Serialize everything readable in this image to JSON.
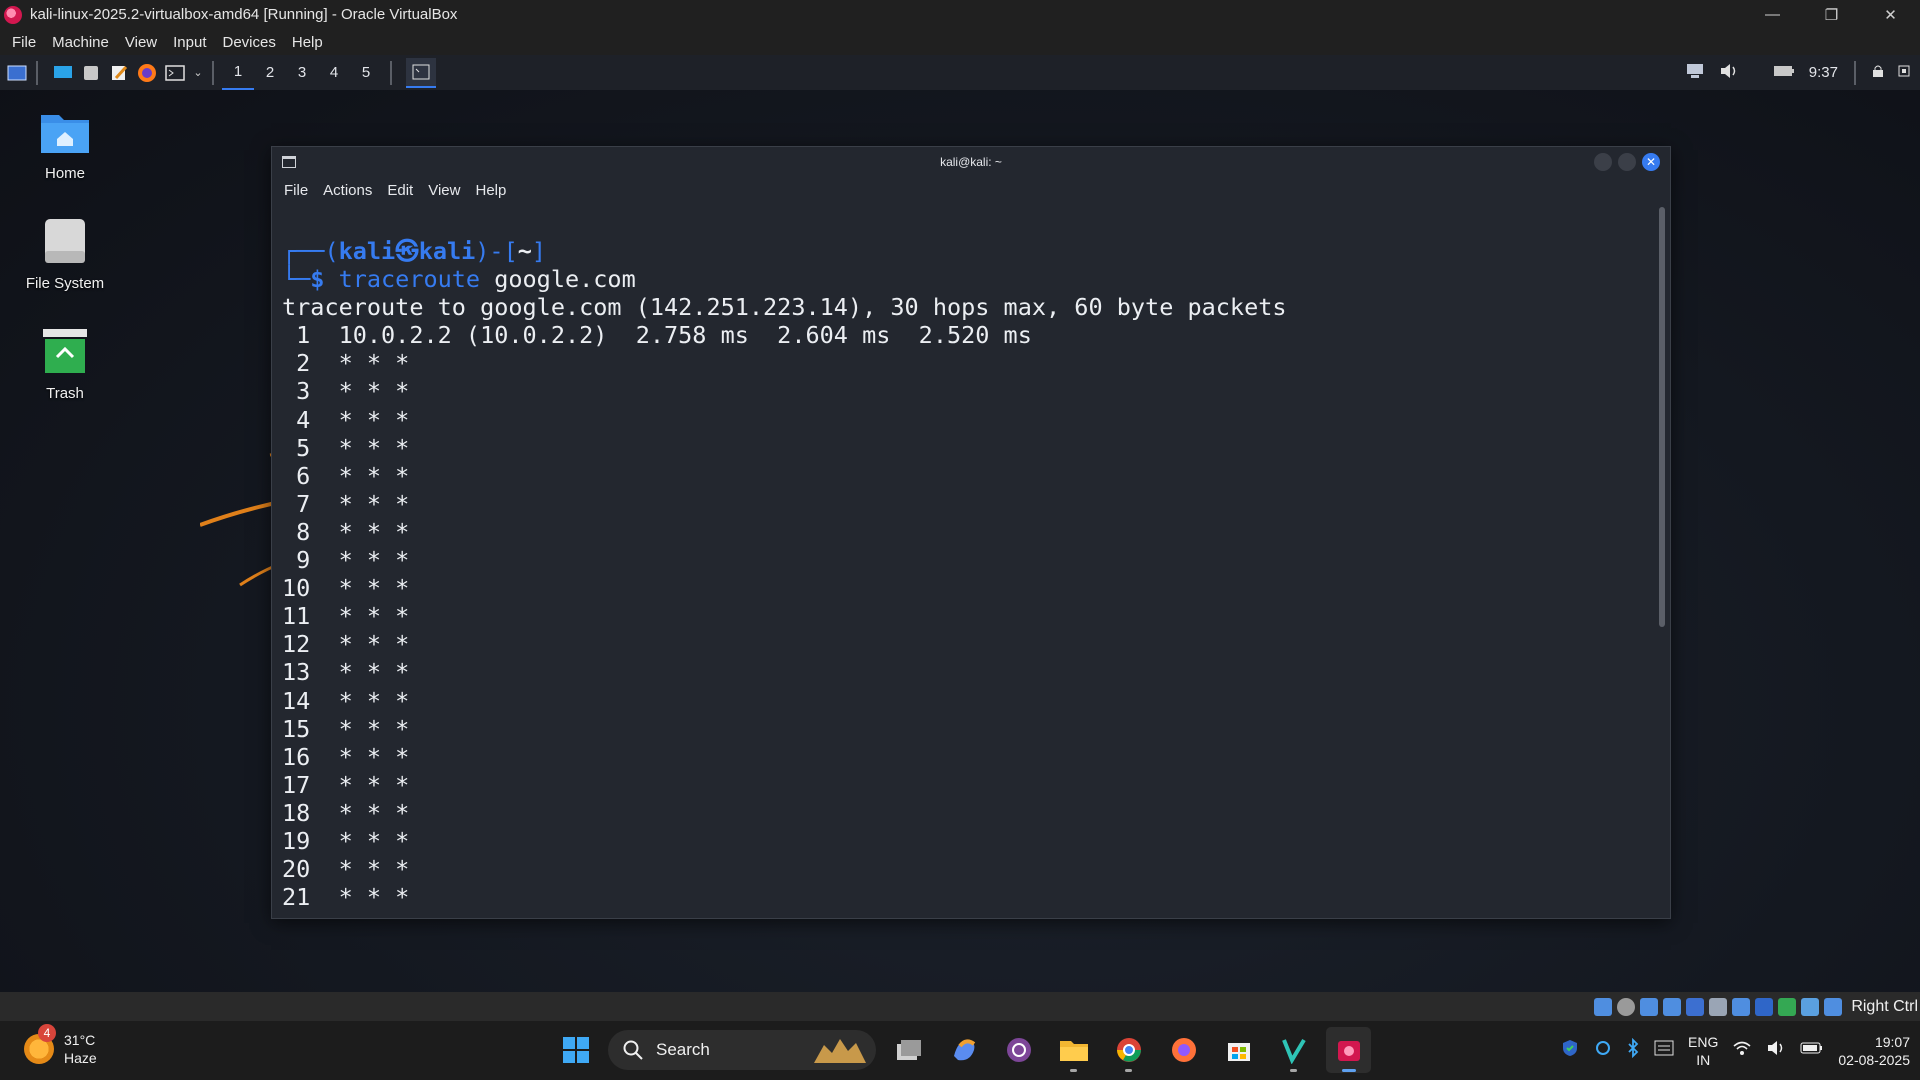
{
  "host": {
    "window_title": "kali-linux-2025.2-virtualbox-amd64 [Running] - Oracle VirtualBox",
    "menu": [
      "File",
      "Machine",
      "View",
      "Input",
      "Devices",
      "Help"
    ],
    "status_right_label": "Right Ctrl"
  },
  "kali_panel": {
    "workspaces": [
      "1",
      "2",
      "3",
      "4",
      "5"
    ],
    "clock": "9:37"
  },
  "desktop": {
    "icons": [
      {
        "label": "Home",
        "icon": "home-folder-icon"
      },
      {
        "label": "File System",
        "icon": "drive-icon"
      },
      {
        "label": "Trash",
        "icon": "trash-icon"
      }
    ]
  },
  "terminal": {
    "title": "kali@kali: ~",
    "menu": [
      "File",
      "Actions",
      "Edit",
      "View",
      "Help"
    ],
    "prompt_user": "kali",
    "prompt_symbol": "㉿",
    "prompt_host": "kali",
    "prompt_dir": "~",
    "command": "traceroute",
    "command_arg": "google.com",
    "output_header": "traceroute to google.com (142.251.223.14), 30 hops max, 60 byte packets",
    "hops": [
      " 1  10.0.2.2 (10.0.2.2)  2.758 ms  2.604 ms  2.520 ms",
      " 2  * * *",
      " 3  * * *",
      " 4  * * *",
      " 5  * * *",
      " 6  * * *",
      " 7  * * *",
      " 8  * * *",
      " 9  * * *",
      "10  * * *",
      "11  * * *",
      "12  * * *",
      "13  * * *",
      "14  * * *",
      "15  * * *",
      "16  * * *",
      "17  * * *",
      "18  * * *",
      "19  * * *",
      "20  * * *",
      "21  * * *"
    ]
  },
  "taskbar": {
    "weather_temp": "31°C",
    "weather_desc": "Haze",
    "weather_badge": "4",
    "search_placeholder": "Search",
    "lang_top": "ENG",
    "lang_bottom": "IN",
    "time": "19:07",
    "date": "02-08-2025"
  },
  "colors": {
    "kali_accent": "#367bf0",
    "terminal_bg": "#23272f",
    "taskbar_bg": "#1c1c1c"
  }
}
